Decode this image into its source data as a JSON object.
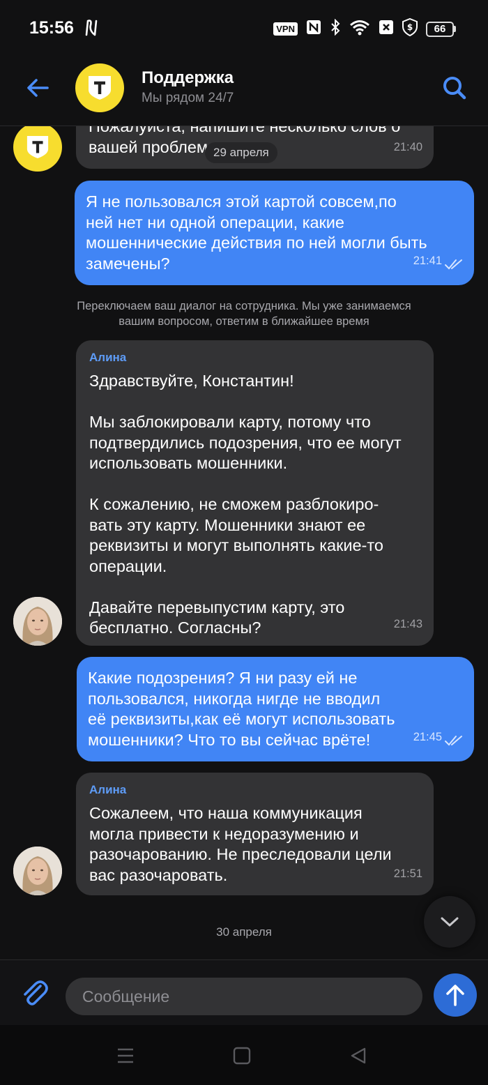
{
  "status_bar": {
    "time": "15:56",
    "vpn": "VPN",
    "battery": "66",
    "icons": [
      "n-icon",
      "nfc-icon",
      "bluetooth-icon",
      "wifi-icon",
      "sim-off-icon",
      "dollar-shield-icon",
      "battery-icon"
    ]
  },
  "header": {
    "title": "Поддержка",
    "subtitle": "Мы рядом 24/7",
    "back_icon": "arrow-left-icon",
    "search_icon": "search-icon",
    "avatar_letter": "T"
  },
  "messages": [
    {
      "from": "support",
      "text": "Пожалуйста, напишите несколько слов о\nвашей проблеме",
      "time": "21:40"
    },
    {
      "from": "me",
      "text": "Я не пользовался этой картой совсем,по\nней нет ни одной операции, какие\nмошеннические действия по ней могли быть\nзамечены?",
      "time": "21:41"
    },
    {
      "from": "system",
      "text": "Переключаем ваш диалог на сотрудника. Мы уже занимаемся\nвашим вопросом, ответим в ближайшее время"
    },
    {
      "from": "agent",
      "sender": "Алина",
      "text": "Здравствуйте, Константин!\n\nМы заблокировали карту, потому что\nподтвердились подозрения, что ее могут\nиспользовать мошенники.\n\nК сожалению, не сможем разблокиро-\nвать эту карту. Мошенники знают ее\nреквизиты и могут выполнять какие-то\nоперации.\n\nДавайте перевыпустим карту, это\nбесплатно. Согласны?",
      "time": "21:43"
    },
    {
      "from": "me",
      "text": "Какие подозрения? Я ни разу ей не\nпользовался, никогда нигде не вводил\nеё реквизиты,как её могут использовать\nмошенники? Что то вы сейчас врёте!",
      "time": "21:45"
    },
    {
      "from": "agent",
      "sender": "Алина",
      "text": "Сожалеем, что наша коммуникация\nмогла привести к недоразумению и\nразочарованию. Не преследовали цели\nвас разочаровать.",
      "time": "21:51"
    }
  ],
  "dates": {
    "sticky": "29 апреля",
    "next": "30 апреля"
  },
  "input": {
    "placeholder": "Сообщение",
    "attach_icon": "paperclip-icon",
    "send_icon": "arrow-up-icon"
  },
  "scroll_down_icon": "chevron-down-icon",
  "nav": {
    "icons": [
      "menu-icon",
      "home-square-icon",
      "back-triangle-icon"
    ]
  },
  "colors": {
    "background": "#111112",
    "incoming_bubble": "#333335",
    "outgoing_bubble": "#4185f5",
    "accent": "#4a8cf7",
    "brand_yellow": "#f7dd2e",
    "sender_name": "#5e9cf7"
  }
}
